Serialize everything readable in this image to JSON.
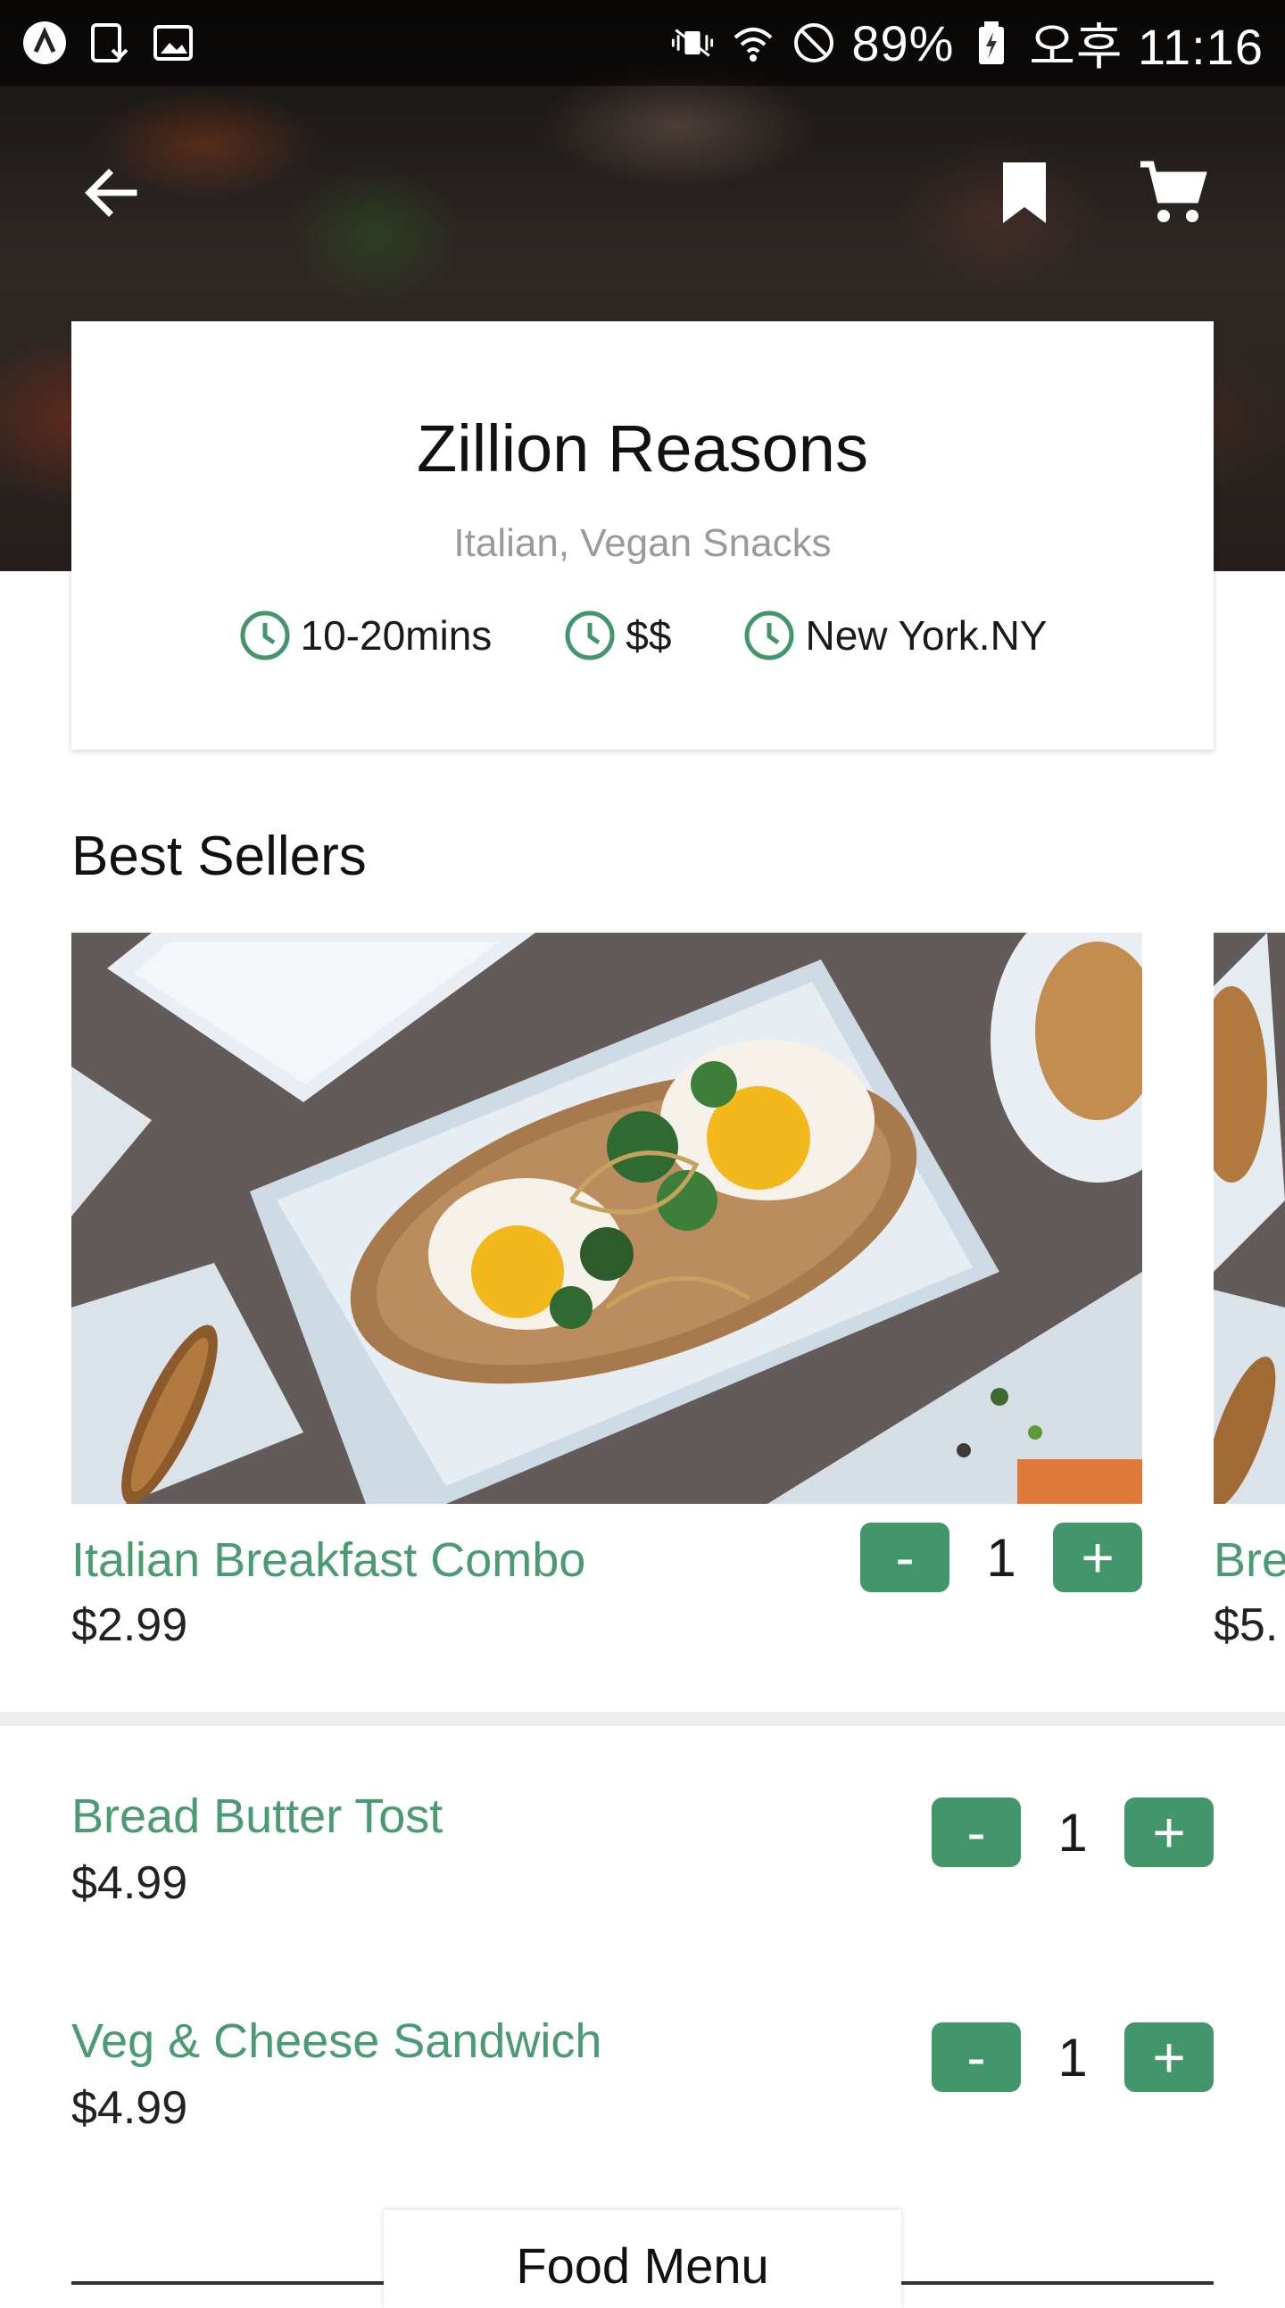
{
  "status_bar": {
    "battery": "89%",
    "time": "오후 11:16"
  },
  "restaurant": {
    "name": "Zillion Reasons",
    "cuisine": "Italian, Vegan Snacks",
    "delivery_time": "10-20mins",
    "price_level": "$$",
    "location": "New York.NY"
  },
  "best_sellers": {
    "title": "Best Sellers",
    "items": [
      {
        "name": "Italian Breakfast Combo",
        "price": "$2.99",
        "qty": "1"
      },
      {
        "name": "Bre",
        "price": "$5."
      }
    ]
  },
  "menu_items": [
    {
      "name": "Bread Butter Tost",
      "price": "$4.99",
      "qty": "1"
    },
    {
      "name": "Veg & Cheese Sandwich",
      "price": "$4.99",
      "qty": "1"
    }
  ],
  "stepper": {
    "minus": "-",
    "plus": "+"
  },
  "bottom_tab": {
    "label": "Food Menu"
  },
  "colors": {
    "accent": "#43966c",
    "item_name": "#4a9a72"
  },
  "icons": {
    "back": "arrow-left-icon",
    "bookmark": "bookmark-icon",
    "cart": "cart-icon",
    "clock": "clock-icon"
  }
}
